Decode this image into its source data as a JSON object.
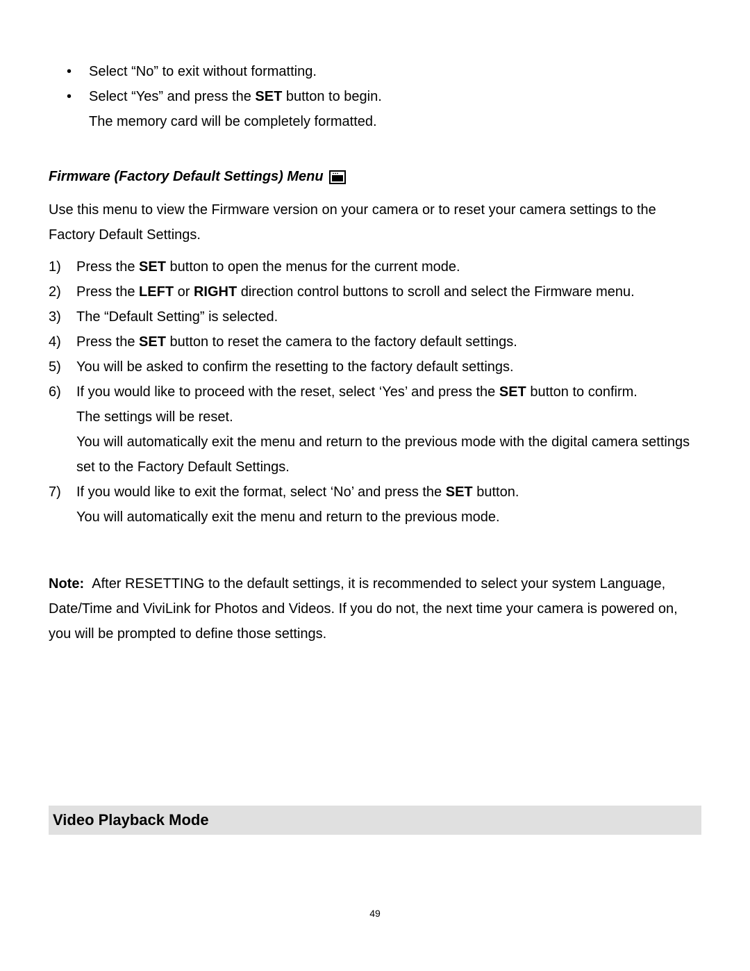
{
  "bullets": {
    "b1": "Select “No” to exit without formatting.",
    "b2a_pre": "Select “Yes” and press the ",
    "b2a_bold": "SET",
    "b2a_post": " button to begin.",
    "b2b": "The memory card will be completely formatted."
  },
  "heading": "Firmware (Factory Default Settings) Menu",
  "intro": "Use this menu to view the Firmware version on your camera or to reset your camera settings to the Factory Default Settings.",
  "steps": {
    "s1": {
      "marker": "1)",
      "pre": "Press the ",
      "b1": "SET",
      "post": " button to open the menus for the current mode."
    },
    "s2": {
      "marker": "2)",
      "pre": "Press the ",
      "b1": "LEFT",
      "mid": " or ",
      "b2": "RIGHT",
      "post": " direction control buttons to scroll and select the Firmware menu."
    },
    "s3": {
      "marker": "3)",
      "text": "The “Default Setting” is selected."
    },
    "s4": {
      "marker": "4)",
      "pre": "Press the ",
      "b1": "SET",
      "post": " button to reset the camera to the factory default settings."
    },
    "s5": {
      "marker": "5)",
      "text": "You will be asked to confirm the resetting to the factory default settings."
    },
    "s6": {
      "marker": "6)",
      "pre": "If you would like to proceed with the reset, select ‘Yes’ and press the ",
      "b1": "SET",
      "post": " button to confirm.",
      "line2": "The settings will be reset.",
      "line3": "You will automatically exit the menu and return to the previous mode with the digital camera settings set to the Factory Default Settings."
    },
    "s7": {
      "marker": "7)",
      "pre": "If you would like to exit the format, select ‘No’ and press the ",
      "b1": "SET",
      "post": " button.",
      "line2": "You will automatically exit the menu and return to the previous mode."
    }
  },
  "note": {
    "label": "Note:",
    "text": "After RESETTING to the default settings, it is recommended to select your system Language, Date/Time and ViviLink for Photos and Videos. If you do not, the next time your camera is powered on, you will be prompted to define those settings."
  },
  "sectionBar": "Video Playback Mode",
  "pageNumber": "49"
}
